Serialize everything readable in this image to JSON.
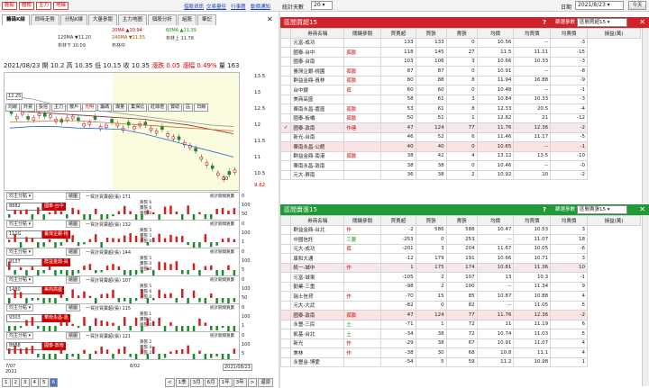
{
  "topbar": {
    "buttons": [
      "輕鬆",
      "體檢",
      "主力",
      "地緣"
    ],
    "links": [
      "借股資訊",
      "交易量佳",
      "行事曆",
      "動價通知"
    ],
    "days_label": "統計天數",
    "days_value": "20",
    "date_label": "日期",
    "date_value": "2021/8/23",
    "today_label": "今天"
  },
  "tabs": [
    "籌碼K線",
    "即時走勢",
    "分點K線",
    "大量參閱",
    "主力地圖",
    "個股分析",
    "組股",
    "筆記"
  ],
  "legend": {
    "ma20": "20MA ▲10.94",
    "ma60": "60MA ▲11.39",
    "ma120": "120MA ▼11.20",
    "ma240": "240MA ▼11.55",
    "bollin": "布林上 11.78",
    "bollin_lower": "布林下 10.09",
    "bollin_mid": "布林中"
  },
  "price": {
    "date": "2021/08/23",
    "open": "開 10.2",
    "high": "高 10.35",
    "low": "低 10.15",
    "close": "收 10.35",
    "change": "漲跌 0.05",
    "pct": "漲幅 0.49%",
    "vol": "量 163"
  },
  "chart_buttons": [
    "均線",
    "外資",
    "投信",
    "主力",
    "散戶",
    "光明",
    "籌碼",
    "爆量",
    "集保比",
    "紅綠燈",
    "贊助",
    "區",
    "日線"
  ],
  "chart_yticks": [
    "13.5",
    "13",
    "12.5",
    "12",
    "11.5",
    "11",
    "10.5",
    "10"
  ],
  "chart_price_tag": "12.25",
  "chart_low_tag": "10",
  "chart_last_tag": "9.62",
  "subs": [
    {
      "sel": "均主分點",
      "draw": "繪圖",
      "code": "8882",
      "tag": "國泰-台中",
      "title": "一買計買賣超(張) 171",
      "lines": [
        "買張 6",
        "賣張 6",
        "買張 0"
      ],
      "note": "統計期間買賣",
      "y": [
        "0",
        "100",
        "50"
      ]
    },
    {
      "sel": "均主分點",
      "draw": "繪圖",
      "code": "111G",
      "tag": "臺灣企銀-桃",
      "title": "一買計買賣超(張) 132",
      "lines": [
        "買張 5",
        "賣張 5",
        "買張 0"
      ],
      "note": "統計期間買賣",
      "y": [
        "0",
        "100",
        "1"
      ]
    },
    {
      "sel": "均主分點",
      "draw": "繪圖",
      "code": "9137",
      "tag": "群益金鼎-員",
      "title": "一買計買賣超(張) 144",
      "lines": [
        "買張 5",
        "賣張 0",
        "買張 0"
      ],
      "note": "統計期間買賣",
      "y": [
        "0",
        "100",
        "5"
      ]
    },
    {
      "sel": "均主分點",
      "draw": "繪圖",
      "code": "1480",
      "tag": "美商高盛",
      "title": "一買計買賣超(張) 107",
      "lines": [
        "買張 5",
        "賣張 6",
        "買張 0"
      ],
      "note": "統計期間買賣",
      "y": [
        "0",
        "100",
        "50"
      ]
    },
    {
      "sel": "均主分點",
      "draw": "繪圖",
      "code": "9303",
      "tag": "華南永昌-嘉",
      "title": "一買計買賣超(張) 115",
      "lines": [
        "買張 1",
        "賣張 1",
        "買張 0"
      ],
      "note": "統計期間買賣",
      "y": [
        "0",
        "100",
        "1"
      ]
    },
    {
      "sel": "均主分點",
      "draw": "繪圖",
      "code": "8888",
      "tag": "國泰-敦南",
      "title": "一買計買賣超(張) 121",
      "lines": [
        "買張 2",
        "賣張 4",
        "賣張 2"
      ],
      "note": "統計期間買賣",
      "y": [
        "0",
        "100",
        "5"
      ]
    }
  ],
  "xaxis": {
    "left": "7/07",
    "left2": "2021",
    "mid": "8/02",
    "right": "2021/08/23"
  },
  "pager": [
    "1",
    "2",
    "3",
    "4",
    "5",
    "6",
    "<",
    "1季",
    "3月",
    "6月",
    "1年",
    "3年",
    ">",
    "還原"
  ],
  "buy_panel": {
    "title": "區間買超15",
    "help": "?",
    "sel_label": "篩選參數",
    "sel_value": "區間買超15",
    "headers": [
      "",
      "券商名稱",
      "關鍵參閱",
      "買賣超",
      "買張",
      "賣張",
      "均價",
      "均買價",
      "均賣價",
      "損益(萬)"
    ],
    "rows": [
      [
        "",
        "元富-成功",
        "",
        "133",
        "133",
        "0",
        "10.56",
        "--",
        "-3"
      ],
      [
        "",
        "國泰-台中",
        "孤臉",
        "118",
        "145",
        "27",
        "11.5",
        "11.11",
        "-15"
      ],
      [
        "",
        "國泰-台南",
        "",
        "103",
        "106",
        "3",
        "10.66",
        "10.33",
        "-3"
      ],
      [
        "",
        "臺灣企銀-桃園",
        "孤臉",
        "87",
        "87",
        "0",
        "10.91",
        "--",
        "-8"
      ],
      [
        "",
        "群益金鼎-員林",
        "孤臉",
        "80",
        "88",
        "8",
        "11.94",
        "16.88",
        "-9"
      ],
      [
        "",
        "台中銀",
        "孤",
        "60",
        "60",
        "0",
        "10.48",
        "--",
        "-1"
      ],
      [
        "",
        "美商高盛",
        "",
        "58",
        "61",
        "3",
        "10.84",
        "10.33",
        "-3"
      ],
      [
        "",
        "華南永昌-嘉盛",
        "孤臉",
        "53",
        "61",
        "8",
        "12.33",
        "20.5",
        "-4"
      ],
      [
        "",
        "國泰-板橋",
        "孤臉",
        "50",
        "51",
        "1",
        "12.82",
        "21",
        "-12"
      ],
      [
        "✓",
        "國泰-敦南",
        "作連",
        "47",
        "124",
        "77",
        "11.76",
        "12.36",
        "-2"
      ],
      [
        "",
        "新光-台南",
        "",
        "46",
        "52",
        "6",
        "11.46",
        "11.17",
        "-5"
      ],
      [
        "",
        "華南永昌-公館",
        "",
        "40",
        "40",
        "0",
        "10.65",
        "--",
        "-1"
      ],
      [
        "",
        "群益金鼎-南港",
        "孤臉",
        "38",
        "42",
        "4",
        "13.12",
        "13.5",
        "-10"
      ],
      [
        "",
        "華南永昌-敦南",
        "",
        "38",
        "38",
        "0",
        "10.46",
        "--",
        "-0"
      ],
      [
        "",
        "元大-屏南",
        "",
        "36",
        "38",
        "2",
        "10.92",
        "10",
        "-2"
      ]
    ],
    "highlight_rows": [
      9,
      11
    ]
  },
  "sell_panel": {
    "title": "區間賣張15",
    "help": "?",
    "sel_label": "篩選參數",
    "sel_value": "區間賣張15",
    "headers": [
      "",
      "券商名稱",
      "關鍵參閱",
      "買賣超",
      "買張",
      "賣張",
      "均價",
      "均買價",
      "均賣價",
      "損益(萬)"
    ],
    "rows": [
      [
        "",
        "群益金鼎-台北",
        "作",
        "-2",
        "586",
        "588",
        "10.47",
        "10.53",
        "3"
      ],
      [
        "",
        "中國信託",
        "三菱",
        "-253",
        "0",
        "253",
        "--",
        "11.07",
        "18"
      ],
      [
        "",
        "元大-成功",
        "孤",
        "-201",
        "3",
        "204",
        "11.67",
        "10.05",
        "-6"
      ],
      [
        "",
        "康和大通",
        "",
        "-12",
        "179",
        "191",
        "10.66",
        "10.71",
        "3"
      ],
      [
        "",
        "統一-城中",
        "作",
        "1",
        "175",
        "174",
        "10.81",
        "11.36",
        "10"
      ],
      [
        "",
        "元富-城東",
        "",
        "-105",
        "2",
        "107",
        "13",
        "10.3",
        "-1"
      ],
      [
        "",
        "勤業-三重",
        "",
        "-98",
        "2",
        "100",
        "--",
        "11.34",
        "9"
      ],
      [
        "",
        "瑞士信貸",
        "作",
        "-70",
        "15",
        "85",
        "10.87",
        "10.88",
        "4"
      ],
      [
        "",
        "元大-大武",
        "",
        "-82",
        "0",
        "82",
        "--",
        "11.05",
        "5"
      ],
      [
        "",
        "國泰-敦南",
        "孤臉",
        "47",
        "124",
        "77",
        "11.76",
        "12.36",
        "-2"
      ],
      [
        "",
        "永豐-三民",
        "土",
        "-71",
        "1",
        "72",
        "11",
        "11.19",
        "6"
      ],
      [
        "",
        "凱基-台北",
        "土",
        "-34",
        "38",
        "72",
        "10.74",
        "11.03",
        "5"
      ],
      [
        "",
        "新光",
        "作",
        "-29",
        "38",
        "67",
        "10.91",
        "11.07",
        "4"
      ],
      [
        "",
        "美林",
        "作",
        "-38",
        "30",
        "68",
        "10.8",
        "11.1",
        "4"
      ],
      [
        "",
        "永豐金-博愛",
        "",
        "-54",
        "5",
        "59",
        "11.2",
        "10.98",
        "1"
      ]
    ],
    "highlight_rows": [
      4,
      9
    ]
  },
  "colors": {
    "red_header": "#d3222a",
    "green_header": "#1e9a36",
    "up": "#d02020",
    "down": "#1a8a2a"
  }
}
